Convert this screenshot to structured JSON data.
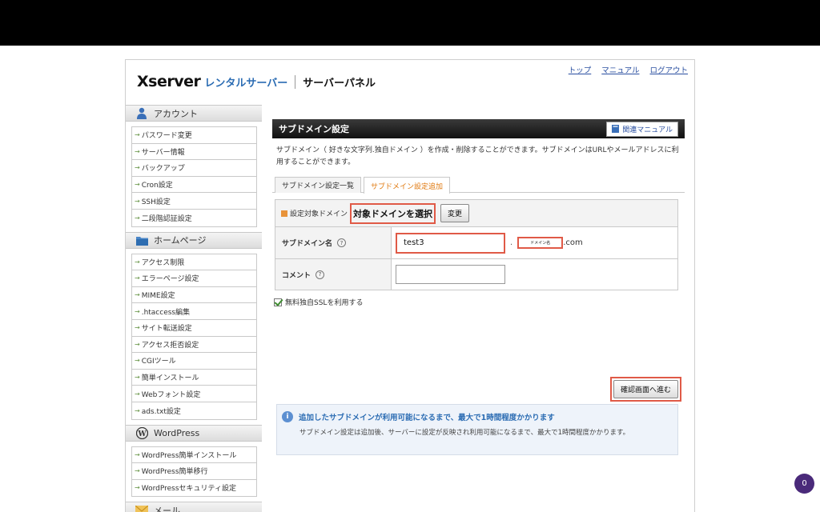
{
  "header": {
    "logo_brand": "Xserver",
    "logo_rental": "レンタルサーバー",
    "logo_panel": "サーバーパネル",
    "links": [
      "トップ",
      "マニュアル",
      "ログアウト"
    ]
  },
  "sidebar": {
    "sections": [
      {
        "title": "アカウント",
        "icon": "user-icon",
        "items": [
          "パスワード変更",
          "サーバー情報",
          "バックアップ",
          "Cron設定",
          "SSH設定",
          "二段階認証設定"
        ]
      },
      {
        "title": "ホームページ",
        "icon": "folder-icon",
        "items": [
          "アクセス制限",
          "エラーページ設定",
          "MIME設定",
          ".htaccess編集",
          "サイト転送設定",
          "アクセス拒否設定",
          "CGIツール",
          "簡単インストール",
          "Webフォント設定",
          "ads.txt設定"
        ]
      },
      {
        "title": "WordPress",
        "icon": "wordpress-icon",
        "items": [
          "WordPress簡単インストール",
          "WordPress簡単移行",
          "WordPressセキュリティ設定"
        ]
      },
      {
        "title": "メール",
        "icon": "mail-icon",
        "items": []
      }
    ]
  },
  "main": {
    "title": "サブドメイン設定",
    "manual_button": "関連マニュアル",
    "description": "サブドメイン（ 好きな文字列.独自ドメイン ）を作成・削除することができます。サブドメインはURLやメールアドレスに利用することができます。",
    "tabs": [
      {
        "label": "サブドメイン設定一覧",
        "active": false
      },
      {
        "label": "サブドメイン設定追加",
        "active": true
      }
    ],
    "form": {
      "target_label": "設定対象ドメイン",
      "target_value": "対象ドメインを選択",
      "change_button": "変更",
      "subdomain_label": "サブドメイン名",
      "subdomain_value": "test3",
      "dot": ".",
      "domain_placeholder": "ドメイン名",
      "domain_suffix": ".com",
      "comment_label": "コメント",
      "help": "?"
    },
    "ssl_label": "無料独自SSLを利用する",
    "confirm_button": "確認画面へ進む",
    "info": {
      "heading": "追加したサブドメインが利用可能になるまで、最大で1時間程度かかります",
      "body": "サブドメイン設定は追加後、サーバーに設定が反映され利用可能になるまで、最大で1時間程度かかります。"
    }
  },
  "badge": "0"
}
